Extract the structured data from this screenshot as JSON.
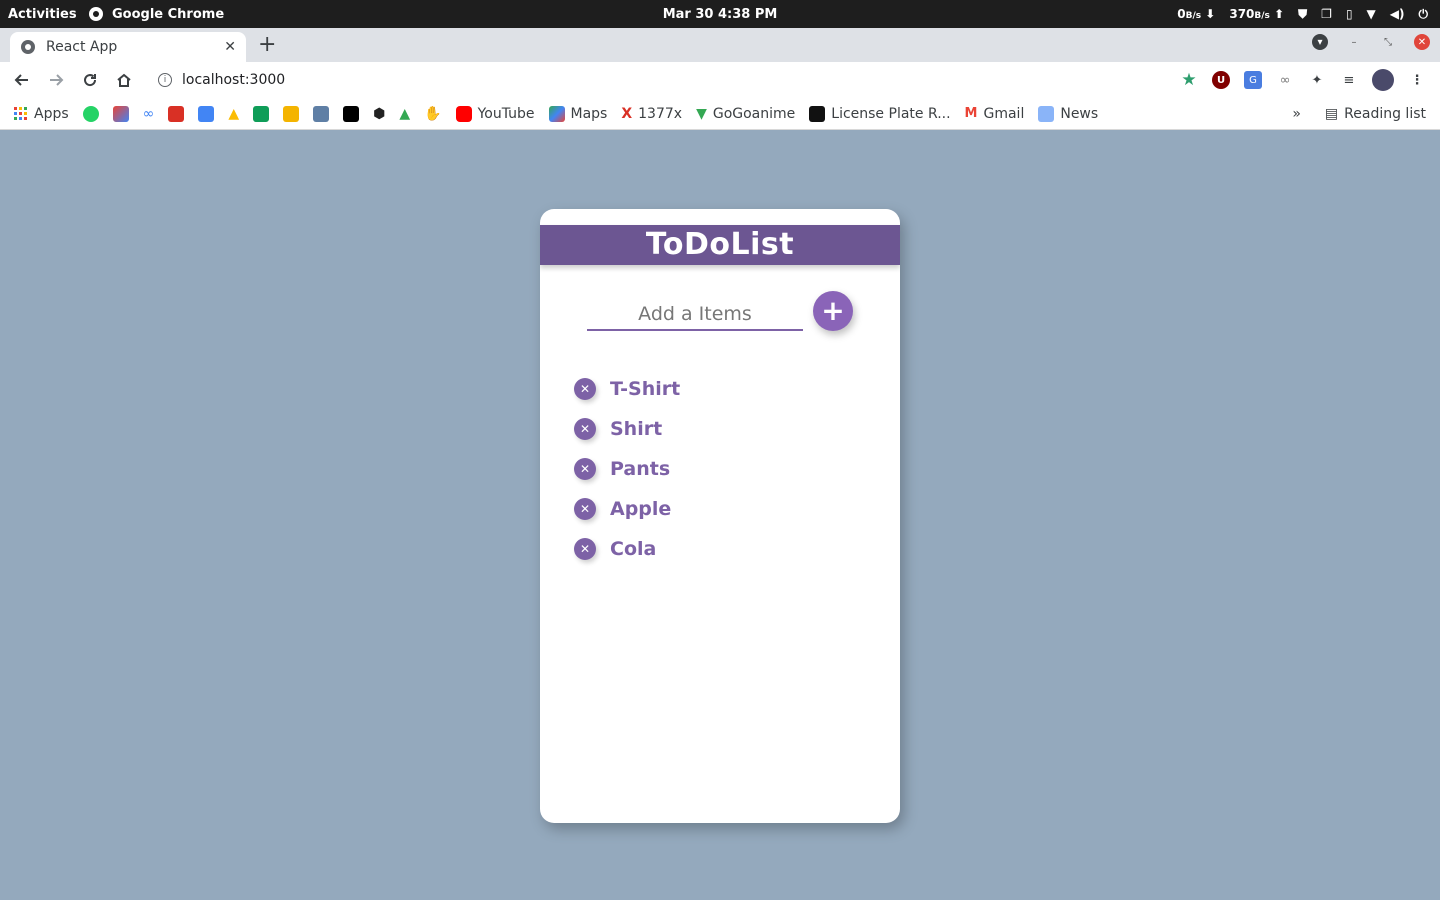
{
  "system": {
    "activities": "Activities",
    "app_name": "Google Chrome",
    "datetime": "Mar 30  4:38 PM",
    "net_down": "0",
    "net_down_unit": "B/s",
    "net_up": "370",
    "net_up_unit": "B/s"
  },
  "browser": {
    "tab_title": "React App",
    "url": "localhost:3000",
    "bookmarks": [
      {
        "label": "Apps",
        "icon": "apps-grid-icon"
      },
      {
        "label": "YouTube",
        "icon": "youtube-icon"
      },
      {
        "label": "Maps",
        "icon": "maps-icon"
      },
      {
        "label": "1377x",
        "icon": "x-icon"
      },
      {
        "label": "GoGoanime",
        "icon": "gogoanime-icon"
      },
      {
        "label": "License Plate R...",
        "icon": "license-plate-icon"
      },
      {
        "label": "Gmail",
        "icon": "gmail-icon"
      },
      {
        "label": "News",
        "icon": "news-icon"
      }
    ],
    "reading_list": "Reading list"
  },
  "app": {
    "title": "ToDoList",
    "input_placeholder": "Add a Items",
    "add_symbol": "+",
    "delete_symbol": "✕",
    "items": [
      "T-Shirt",
      "Shirt",
      "Pants",
      "Apple",
      "Cola"
    ]
  },
  "colors": {
    "page_bg": "#94a9bd",
    "header_bg": "#6c5692",
    "accent": "#7d62a6"
  }
}
